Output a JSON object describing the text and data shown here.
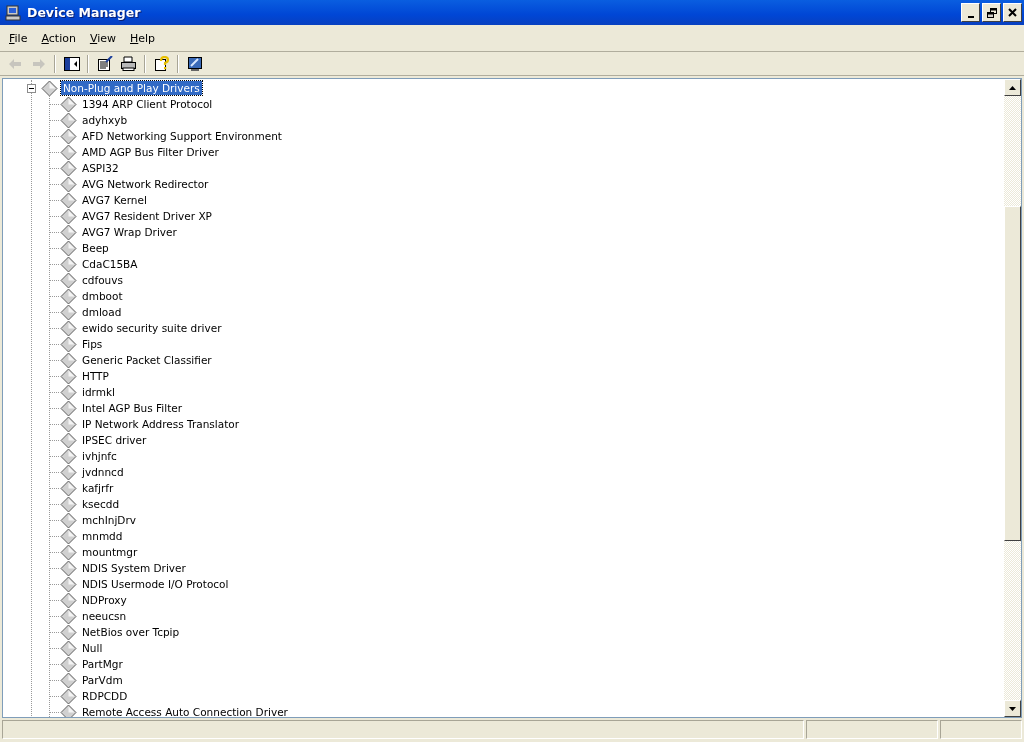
{
  "window": {
    "title": "Device Manager"
  },
  "menu": [
    {
      "label": "File"
    },
    {
      "label": "Action"
    },
    {
      "label": "View"
    },
    {
      "label": "Help"
    }
  ],
  "toolbar": [
    {
      "kind": "back",
      "disabled": true
    },
    {
      "kind": "forward",
      "disabled": true
    },
    {
      "kind": "separator"
    },
    {
      "kind": "tree",
      "disabled": false
    },
    {
      "kind": "separator"
    },
    {
      "kind": "properties",
      "disabled": false
    },
    {
      "kind": "print",
      "disabled": false
    },
    {
      "kind": "separator"
    },
    {
      "kind": "help",
      "disabled": false
    },
    {
      "kind": "separator"
    },
    {
      "kind": "scan",
      "disabled": false
    }
  ],
  "tree": {
    "label": "Non-Plug and Play Drivers",
    "expanded": true,
    "selected": true,
    "children": [
      {
        "label": "1394 ARP Client Protocol",
        "selected": false
      },
      {
        "label": "adyhxyb",
        "selected": false
      },
      {
        "label": "AFD Networking Support Environment",
        "selected": false
      },
      {
        "label": "AMD AGP Bus Filter Driver",
        "selected": false
      },
      {
        "label": "ASPI32",
        "selected": false
      },
      {
        "label": "AVG Network Redirector",
        "selected": false
      },
      {
        "label": "AVG7 Kernel",
        "selected": false
      },
      {
        "label": "AVG7 Resident Driver XP",
        "selected": false
      },
      {
        "label": "AVG7 Wrap Driver",
        "selected": false
      },
      {
        "label": "Beep",
        "selected": false
      },
      {
        "label": "CdaC15BA",
        "selected": false
      },
      {
        "label": "cdfouvs",
        "selected": false
      },
      {
        "label": "dmboot",
        "selected": false
      },
      {
        "label": "dmload",
        "selected": false
      },
      {
        "label": "ewido security suite driver",
        "selected": false
      },
      {
        "label": "Fips",
        "selected": false
      },
      {
        "label": "Generic Packet Classifier",
        "selected": false
      },
      {
        "label": "HTTP",
        "selected": false
      },
      {
        "label": "idrmkl",
        "selected": false
      },
      {
        "label": "Intel AGP Bus Filter",
        "selected": false
      },
      {
        "label": "IP Network Address Translator",
        "selected": false
      },
      {
        "label": "IPSEC driver",
        "selected": false
      },
      {
        "label": "ivhjnfc",
        "selected": false
      },
      {
        "label": "jvdnncd",
        "selected": false
      },
      {
        "label": "kafjrfr",
        "selected": false
      },
      {
        "label": "ksecdd",
        "selected": false
      },
      {
        "label": "mchInjDrv",
        "selected": false
      },
      {
        "label": "mnmdd",
        "selected": false
      },
      {
        "label": "mountmgr",
        "selected": false
      },
      {
        "label": "NDIS System Driver",
        "selected": false
      },
      {
        "label": "NDIS Usermode I/O Protocol",
        "selected": false
      },
      {
        "label": "NDProxy",
        "selected": false
      },
      {
        "label": "neeucsn",
        "selected": false
      },
      {
        "label": "NetBios over Tcpip",
        "selected": false
      },
      {
        "label": "Null",
        "selected": false
      },
      {
        "label": "PartMgr",
        "selected": false
      },
      {
        "label": "ParVdm",
        "selected": false
      },
      {
        "label": "RDPCDD",
        "selected": false
      },
      {
        "label": "Remote Access Auto Connection Driver",
        "selected": false
      }
    ]
  }
}
